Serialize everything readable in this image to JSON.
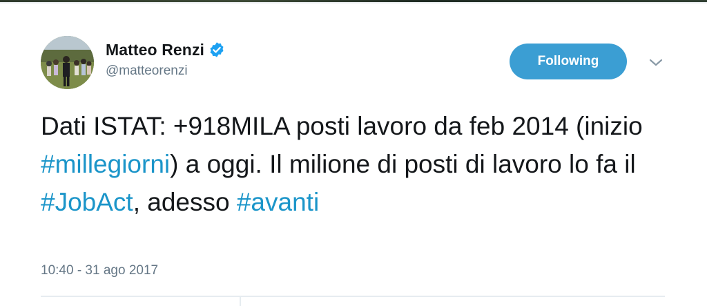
{
  "tweet": {
    "author": {
      "display_name": "Matteo Renzi",
      "handle": "@matteorenzi",
      "verified": true,
      "avatar_icon": "profile-photo"
    },
    "follow_button_label": "Following",
    "menu_icon": "chevron-down-icon",
    "text_parts": [
      {
        "type": "text",
        "value": "Dati ISTAT: +918MILA posti lavoro da feb 2014 (inizio "
      },
      {
        "type": "hashtag",
        "value": "#millegiorni"
      },
      {
        "type": "text",
        "value": ") a oggi. Il milione di posti di lavoro lo fa il "
      },
      {
        "type": "hashtag",
        "value": "#JobAct"
      },
      {
        "type": "text",
        "value": ", adesso "
      },
      {
        "type": "hashtag",
        "value": "#avanti"
      }
    ],
    "timestamp": "10:40 - 31 ago 2017"
  },
  "colors": {
    "follow_button": "#3b9ed3",
    "hashtag": "#1b95c9",
    "verified_badge": "#1da1f2",
    "secondary_text": "#657786"
  }
}
